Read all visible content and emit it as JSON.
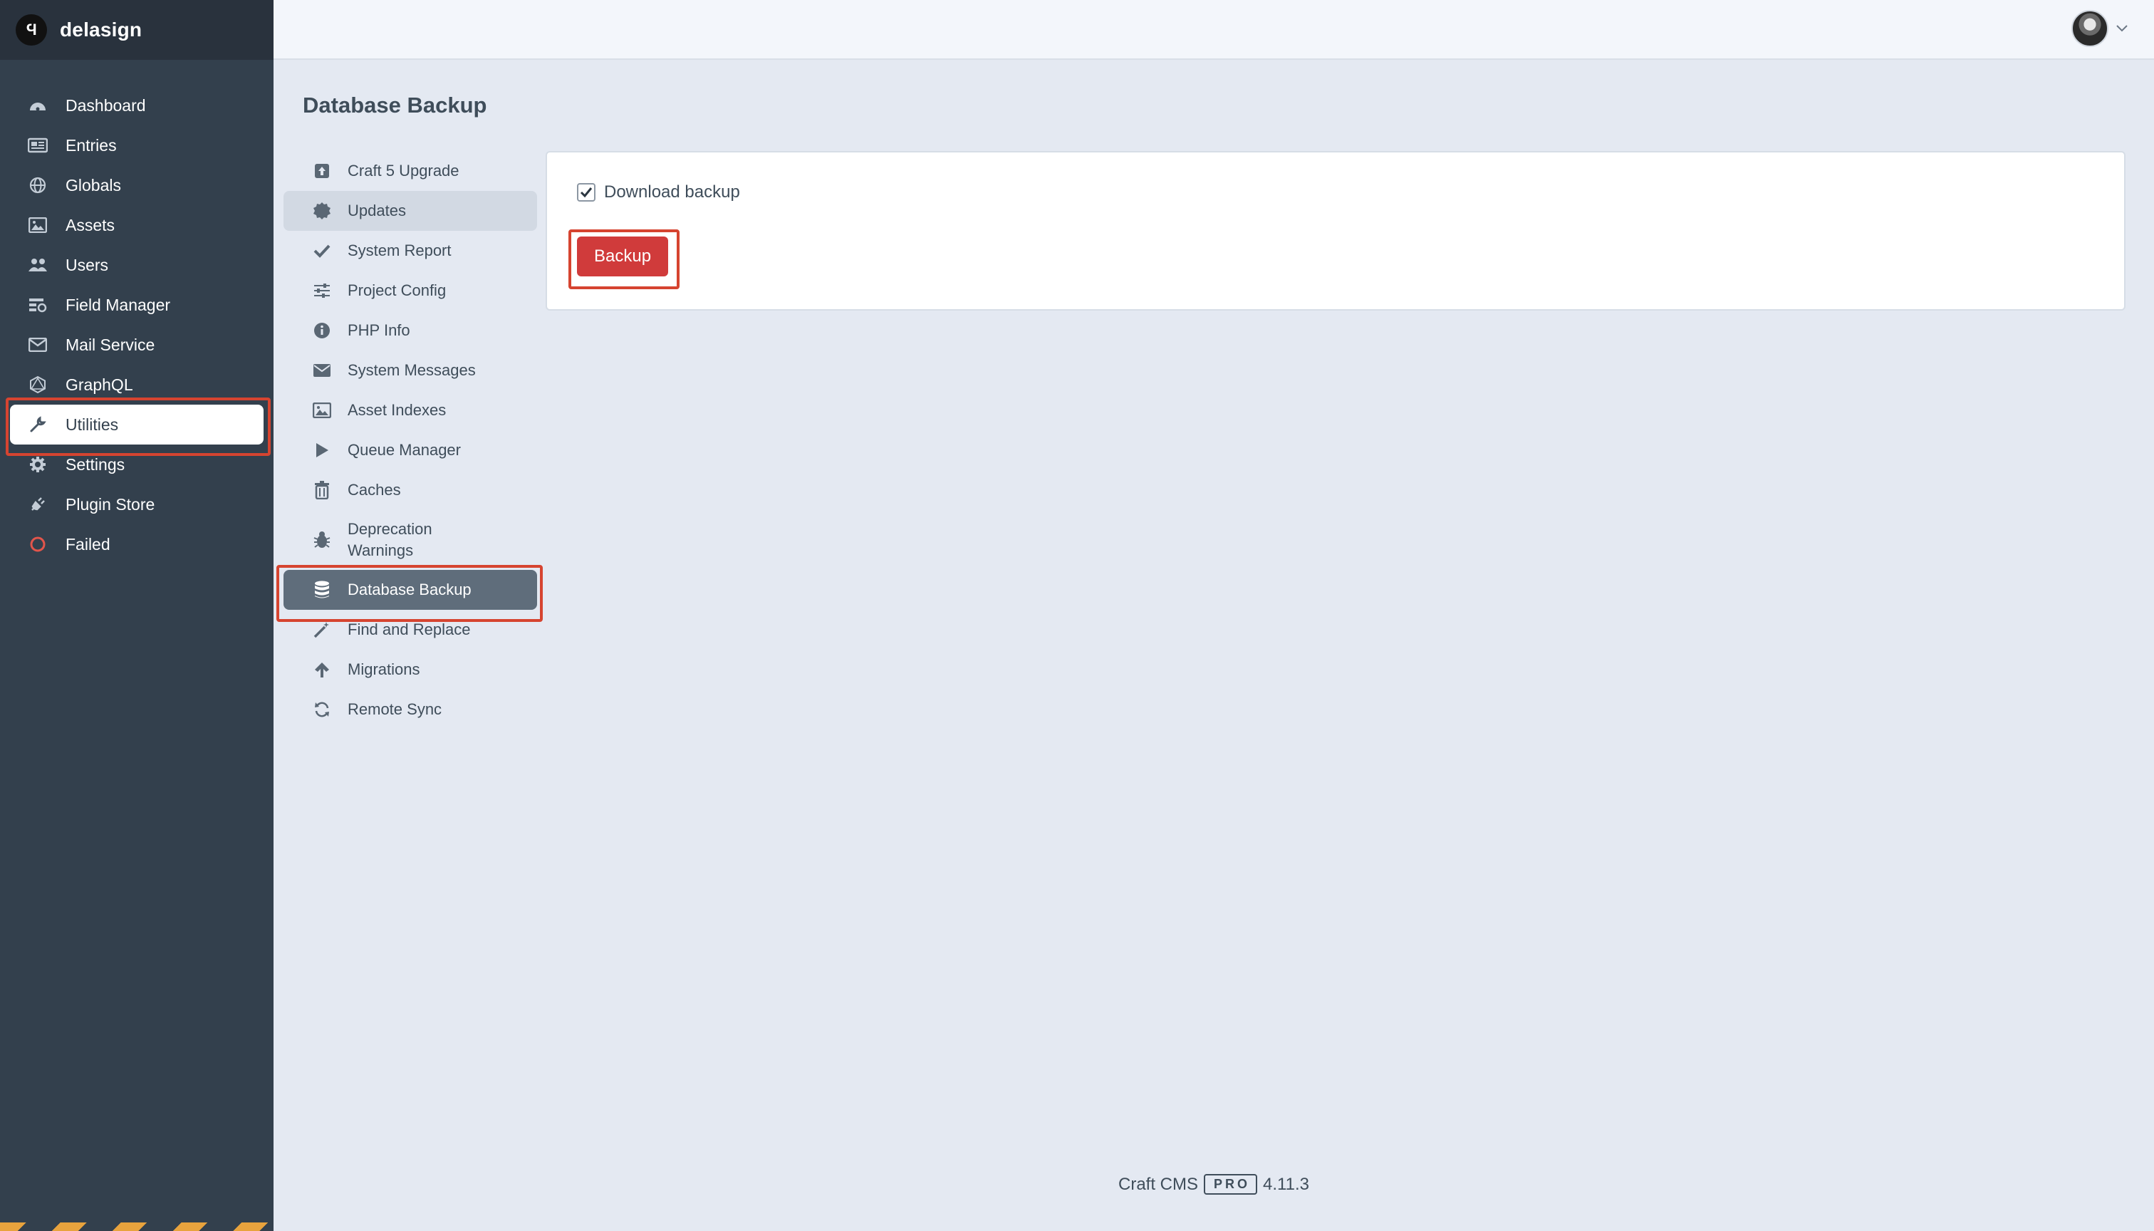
{
  "site": {
    "logo": "Ϥ",
    "name": "delasign"
  },
  "global_nav": [
    {
      "label": "Dashboard",
      "icon": "gauge-icon"
    },
    {
      "label": "Entries",
      "icon": "newspaper-icon"
    },
    {
      "label": "Globals",
      "icon": "globe-icon"
    },
    {
      "label": "Assets",
      "icon": "image-icon"
    },
    {
      "label": "Users",
      "icon": "users-icon"
    },
    {
      "label": "Field Manager",
      "icon": "field-manager-icon"
    },
    {
      "label": "Mail Service",
      "icon": "envelope-icon"
    },
    {
      "label": "GraphQL",
      "icon": "graphql-icon"
    },
    {
      "label": "Utilities",
      "icon": "wrench-icon"
    },
    {
      "label": "Settings",
      "icon": "gear-icon"
    },
    {
      "label": "Plugin Store",
      "icon": "plug-icon"
    },
    {
      "label": "Failed",
      "icon": "failed-circle-icon"
    }
  ],
  "page": {
    "title": "Database Backup"
  },
  "utilities_nav": [
    {
      "label": "Craft 5 Upgrade",
      "icon": "upload-icon"
    },
    {
      "label": "Updates",
      "icon": "badge-icon"
    },
    {
      "label": "System Report",
      "icon": "check-icon"
    },
    {
      "label": "Project Config",
      "icon": "sliders-icon"
    },
    {
      "label": "PHP Info",
      "icon": "info-icon"
    },
    {
      "label": "System Messages",
      "icon": "envelope-icon"
    },
    {
      "label": "Asset Indexes",
      "icon": "image-icon"
    },
    {
      "label": "Queue Manager",
      "icon": "play-icon"
    },
    {
      "label": "Caches",
      "icon": "trash-icon"
    },
    {
      "label": "Deprecation Warnings",
      "icon": "bug-icon"
    },
    {
      "label": "Database Backup",
      "icon": "database-icon"
    },
    {
      "label": "Find and Replace",
      "icon": "wand-icon"
    },
    {
      "label": "Migrations",
      "icon": "arrow-up-icon"
    },
    {
      "label": "Remote Sync",
      "icon": "sync-icon"
    }
  ],
  "backup": {
    "checkbox_label": "Download backup",
    "checked": true,
    "button_label": "Backup"
  },
  "footer": {
    "product": "Craft CMS",
    "edition": "PRO",
    "version": "4.11.3"
  },
  "colors": {
    "sidebar": "#33404d",
    "accent_red": "#d03b3b",
    "highlight": "#d64430"
  }
}
